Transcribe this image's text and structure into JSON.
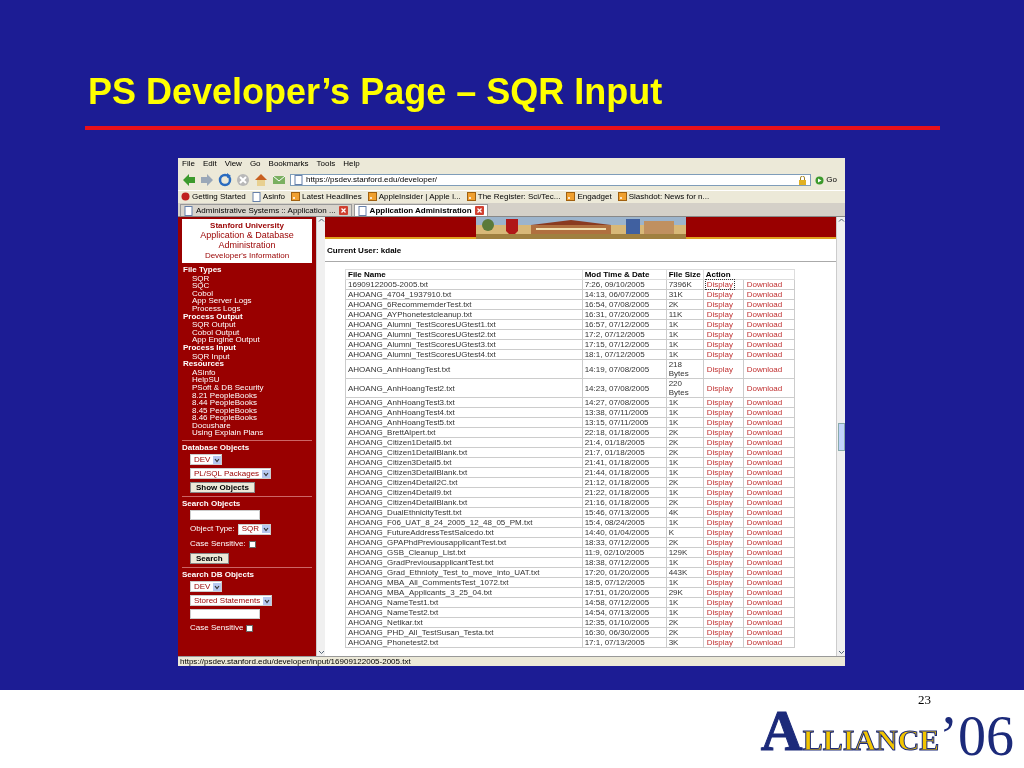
{
  "slide": {
    "title": "PS Developer’s Page – SQR Input",
    "page_number": "23",
    "logo_word": "ALLIANCE",
    "logo_year": "’06"
  },
  "browser": {
    "menu": [
      "File",
      "Edit",
      "View",
      "Go",
      "Bookmarks",
      "Tools",
      "Help"
    ],
    "url": "https://psdev.stanford.edu/developer/",
    "go_label": "Go",
    "bookmarks": [
      {
        "label": "Getting Started",
        "kind": "start"
      },
      {
        "label": "Asinfo",
        "kind": "page"
      },
      {
        "label": "Latest Headlines",
        "kind": "feed"
      },
      {
        "label": "AppleInsider | Apple I...",
        "kind": "feed"
      },
      {
        "label": "The Register: Sci/Tec...",
        "kind": "feed"
      },
      {
        "label": "Engadget",
        "kind": "feed"
      },
      {
        "label": "Slashdot: News for n...",
        "kind": "feed"
      }
    ],
    "tabs": [
      {
        "label": "Administrative Systems :: Application ...",
        "selected": false
      },
      {
        "label": "Application Administration",
        "selected": true
      }
    ],
    "status_text": "https://psdev.stanford.edu/developer/input/16909122005-2005.txt"
  },
  "sidebar": {
    "university": "Stanford University",
    "app_title": "Application & Database Administration",
    "subtitle": "Developer's Information",
    "sections": [
      {
        "heading": "File Types",
        "links": [
          "SQR",
          "SQC",
          "Cobol",
          "App Server Logs",
          "Process Logs"
        ]
      },
      {
        "heading": "Process Output",
        "links": [
          "SQR Output",
          "Cobol Output",
          "App Engine Output"
        ]
      },
      {
        "heading": "Process Input",
        "links": [
          "SQR Input"
        ]
      },
      {
        "heading": "Resources",
        "links": [
          "ASinfo",
          "HelpSU",
          "PSoft & DB Security",
          "8.21 PeopleBooks",
          "8.44 PeopleBooks",
          "8.45 PeopleBooks",
          "8.46 PeopleBooks",
          "Docushare",
          "Using Explain Plans"
        ]
      }
    ],
    "forms": [
      {
        "heading": "Database Objects",
        "controls": [
          {
            "kind": "select",
            "value": "DEV"
          },
          {
            "kind": "select",
            "value": "PL/SQL Packages"
          },
          {
            "kind": "button",
            "label": "Show Objects"
          }
        ]
      },
      {
        "heading": "Search Objects",
        "controls": [
          {
            "kind": "text"
          },
          {
            "kind": "select",
            "label": "Object Type:",
            "value": "SQR"
          },
          {
            "kind": "checkbox",
            "label": "Case Sensitive:",
            "checked": false
          },
          {
            "kind": "button",
            "label": "Search"
          }
        ]
      },
      {
        "heading": "Search DB Objects",
        "controls": [
          {
            "kind": "select",
            "value": "DEV"
          },
          {
            "kind": "select",
            "value": "Stored Statements"
          },
          {
            "kind": "text"
          },
          {
            "kind": "checkbox",
            "label": "Case Sensitive",
            "checked": false
          }
        ]
      }
    ]
  },
  "content": {
    "current_user": "Current User: kdale",
    "table": {
      "columns": [
        "File Name",
        "Mod Time & Date",
        "File Size",
        "Action"
      ],
      "rows": [
        {
          "name": "16909122005-2005.txt",
          "time": "7:26, 09/10/2005",
          "size": "7396K",
          "display": "Display",
          "download": "Download",
          "focused": true
        },
        {
          "name": "AHOANG_4704_1937910.txt",
          "time": "14:13, 06/07/2005",
          "size": "31K",
          "display": "Display",
          "download": "Download",
          "focused": false
        },
        {
          "name": "AHOANG_6RecommemderTest.txt",
          "time": "16:54, 07/08/2005",
          "size": "2K",
          "display": "Display",
          "download": "Download",
          "focused": false
        },
        {
          "name": "AHOANG_AYPhonetestcleanup.txt",
          "time": "16:31, 07/20/2005",
          "size": "11K",
          "display": "Display",
          "download": "Download",
          "focused": false
        },
        {
          "name": "AHOANG_Alumni_TestScoresUGtest1.txt",
          "time": "16:57, 07/12/2005",
          "size": "1K",
          "display": "Display",
          "download": "Download",
          "focused": false
        },
        {
          "name": "AHOANG_Alumni_TestScoresUGtest2.txt",
          "time": "17:2, 07/12/2005",
          "size": "1K",
          "display": "Display",
          "download": "Download",
          "focused": false
        },
        {
          "name": "AHOANG_Alumni_TestScoresUGtest3.txt",
          "time": "17:15, 07/12/2005",
          "size": "1K",
          "display": "Display",
          "download": "Download",
          "focused": false
        },
        {
          "name": "AHOANG_Alumni_TestScoresUGtest4.txt",
          "time": "18:1, 07/12/2005",
          "size": "1K",
          "display": "Display",
          "download": "Download",
          "focused": false
        },
        {
          "name": "AHOANG_AnhHoangTest.txt",
          "time": "14:19, 07/08/2005",
          "size": "218 Bytes",
          "display": "Display",
          "download": "Download",
          "focused": false
        },
        {
          "name": "AHOANG_AnhHoangTest2.txt",
          "time": "14:23, 07/08/2005",
          "size": "220 Bytes",
          "display": "Display",
          "download": "Download",
          "focused": false
        },
        {
          "name": "AHOANG_AnhHoangTest3.txt",
          "time": "14:27, 07/08/2005",
          "size": "1K",
          "display": "Display",
          "download": "Download",
          "focused": false
        },
        {
          "name": "AHOANG_AnhHoangTest4.txt",
          "time": "13:38, 07/11/2005",
          "size": "1K",
          "display": "Display",
          "download": "Download",
          "focused": false
        },
        {
          "name": "AHOANG_AnhHoangTest5.txt",
          "time": "13:15, 07/11/2005",
          "size": "1K",
          "display": "Display",
          "download": "Download",
          "focused": false
        },
        {
          "name": "AHOANG_BrettAlpert.txt",
          "time": "22:18, 01/18/2005",
          "size": "2K",
          "display": "Display",
          "download": "Download",
          "focused": false
        },
        {
          "name": "AHOANG_Citizen1Detail5.txt",
          "time": "21:4, 01/18/2005",
          "size": "2K",
          "display": "Display",
          "download": "Download",
          "focused": false
        },
        {
          "name": "AHOANG_Citizen1DetailBlank.txt",
          "time": "21:7, 01/18/2005",
          "size": "2K",
          "display": "Display",
          "download": "Download",
          "focused": false
        },
        {
          "name": "AHOANG_Citizen3Detail5.txt",
          "time": "21:41, 01/18/2005",
          "size": "1K",
          "display": "Display",
          "download": "Download",
          "focused": false
        },
        {
          "name": "AHOANG_Citizen3DetailBlank.txt",
          "time": "21:44, 01/18/2005",
          "size": "1K",
          "display": "Display",
          "download": "Download",
          "focused": false
        },
        {
          "name": "AHOANG_Citizen4Detail2C.txt",
          "time": "21:12, 01/18/2005",
          "size": "2K",
          "display": "Display",
          "download": "Download",
          "focused": false
        },
        {
          "name": "AHOANG_Citizen4Detail9.txt",
          "time": "21:22, 01/18/2005",
          "size": "1K",
          "display": "Display",
          "download": "Download",
          "focused": false
        },
        {
          "name": "AHOANG_Citizen4DetailBlank.txt",
          "time": "21:16, 01/18/2005",
          "size": "2K",
          "display": "Display",
          "download": "Download",
          "focused": false
        },
        {
          "name": "AHOANG_DualEthnicityTestt.txt",
          "time": "15:46, 07/13/2005",
          "size": "4K",
          "display": "Display",
          "download": "Download",
          "focused": false
        },
        {
          "name": "AHOANG_F06_UAT_8_24_2005_12_48_05_PM.txt",
          "time": "15:4, 08/24/2005",
          "size": "1K",
          "display": "Display",
          "download": "Download",
          "focused": false
        },
        {
          "name": "AHOANG_FutureAddressTestSalcedo.txt",
          "time": "14:40, 01/04/2005",
          "size": "K",
          "display": "Display",
          "download": "Download",
          "focused": false
        },
        {
          "name": "AHOANG_GPAPhdPreviousapplicantTest.txt",
          "time": "18:33, 07/12/2005",
          "size": "2K",
          "display": "Display",
          "download": "Download",
          "focused": false
        },
        {
          "name": "AHOANG_GSB_Cleanup_List.txt",
          "time": "11:9, 02/10/2005",
          "size": "129K",
          "display": "Display",
          "download": "Download",
          "focused": false
        },
        {
          "name": "AHOANG_GradPreviousapplicantTest.txt",
          "time": "18:38, 07/12/2005",
          "size": "1K",
          "display": "Display",
          "download": "Download",
          "focused": false
        },
        {
          "name": "AHOANG_Grad_Ethnioty_Test_to_move_into_UAT.txt",
          "time": "17:20, 01/20/2005",
          "size": "443K",
          "display": "Display",
          "download": "Download",
          "focused": false
        },
        {
          "name": "AHOANG_MBA_All_CommentsTest_1072.txt",
          "time": "18:5, 07/12/2005",
          "size": "1K",
          "display": "Display",
          "download": "Download",
          "focused": false
        },
        {
          "name": "AHOANG_MBA_Applicants_3_25_04.txt",
          "time": "17:51, 01/20/2005",
          "size": "29K",
          "display": "Display",
          "download": "Download",
          "focused": false
        },
        {
          "name": "AHOANG_NameTest1.txt",
          "time": "14:58, 07/12/2005",
          "size": "1K",
          "display": "Display",
          "download": "Download",
          "focused": false
        },
        {
          "name": "AHOANG_NameTest2.txt",
          "time": "14:54, 07/13/2005",
          "size": "1K",
          "display": "Display",
          "download": "Download",
          "focused": false
        },
        {
          "name": "AHOANG_Netikar.txt",
          "time": "12:35, 01/10/2005",
          "size": "2K",
          "display": "Display",
          "download": "Download",
          "focused": false
        },
        {
          "name": "AHOANG_PHD_All_TestSusan_Testa.txt",
          "time": "16:30, 06/30/2005",
          "size": "2K",
          "display": "Display",
          "download": "Download",
          "focused": false
        },
        {
          "name": "AHOANG_Phonetest2.txt",
          "time": "17:1, 07/13/2005",
          "size": "3K",
          "display": "Display",
          "download": "Download",
          "focused": false
        }
      ]
    }
  }
}
